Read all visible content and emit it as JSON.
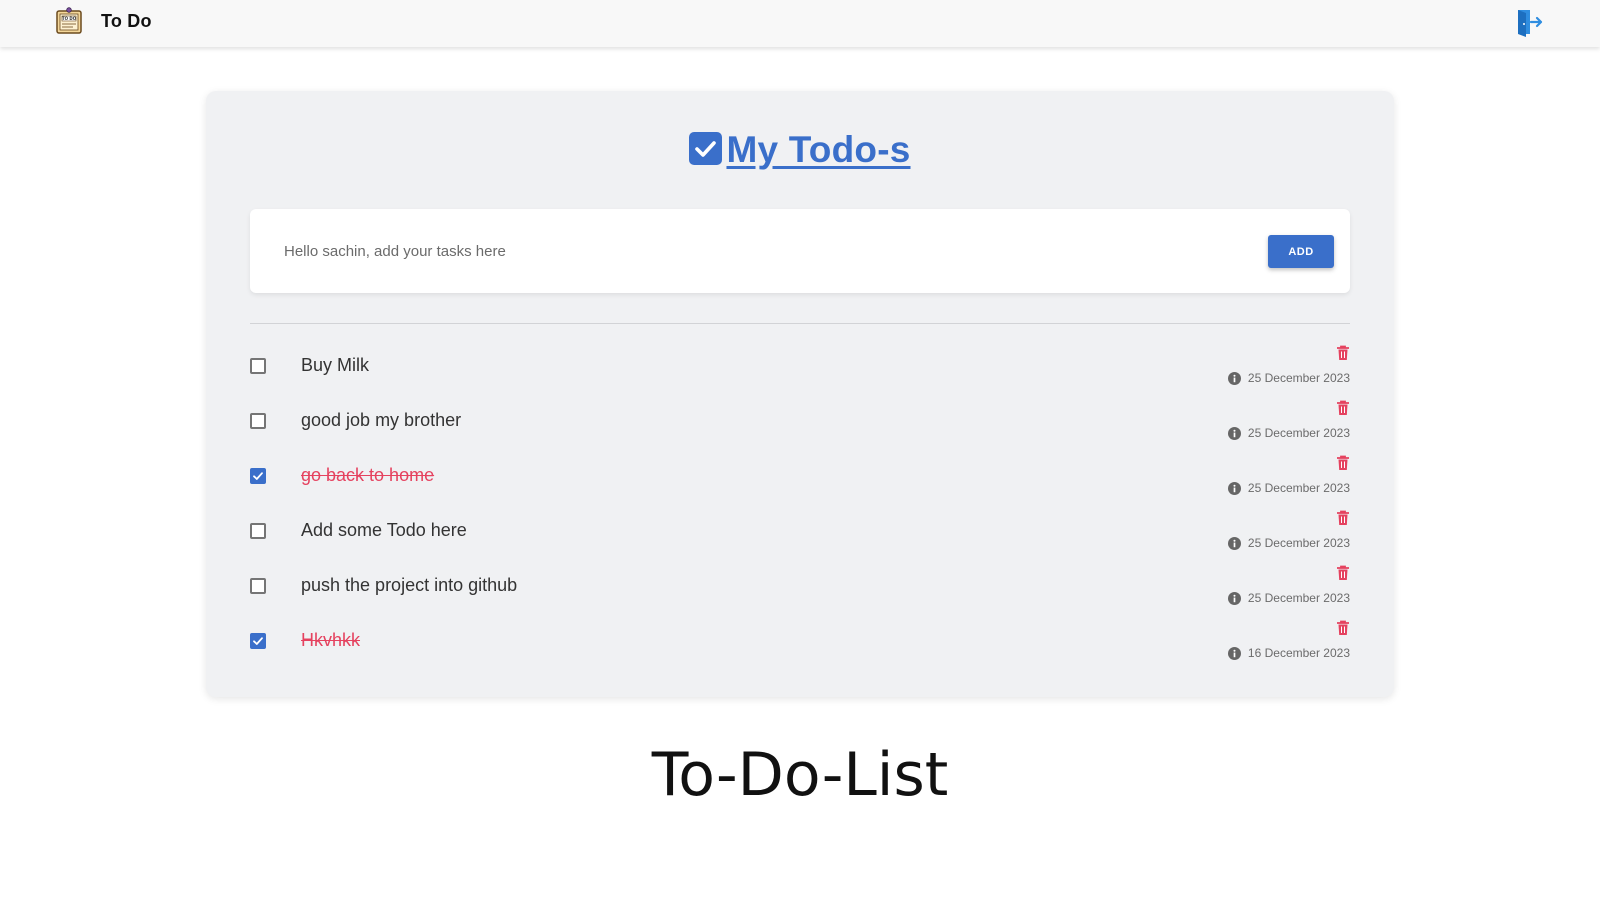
{
  "navbar": {
    "brand": "To Do",
    "logo_icon": "todo-notepad-icon",
    "logout_icon": "logout-door-icon"
  },
  "card": {
    "heading": "My Todo-s",
    "heading_icon": "checkbox-checked-icon",
    "input": {
      "placeholder": "Hello sachin, add your tasks here",
      "value": ""
    },
    "add_label": "ADD"
  },
  "todos": [
    {
      "text": "Buy Milk",
      "done": false,
      "date": "25 December 2023"
    },
    {
      "text": "good job my brother",
      "done": false,
      "date": "25 December 2023"
    },
    {
      "text": "go back to home",
      "done": true,
      "date": "25 December 2023"
    },
    {
      "text": "Add some Todo here",
      "done": false,
      "date": "25 December 2023"
    },
    {
      "text": "push the project into github",
      "done": false,
      "date": "25 December 2023"
    },
    {
      "text": "Hkvhkk",
      "done": true,
      "date": "16 December 2023"
    }
  ],
  "footer": {
    "title": "To-Do-List"
  },
  "colors": {
    "accent": "#3a6fca",
    "danger": "#e5425f",
    "card_bg": "#f0f1f3",
    "navbar_bg": "#f8f8f8"
  }
}
